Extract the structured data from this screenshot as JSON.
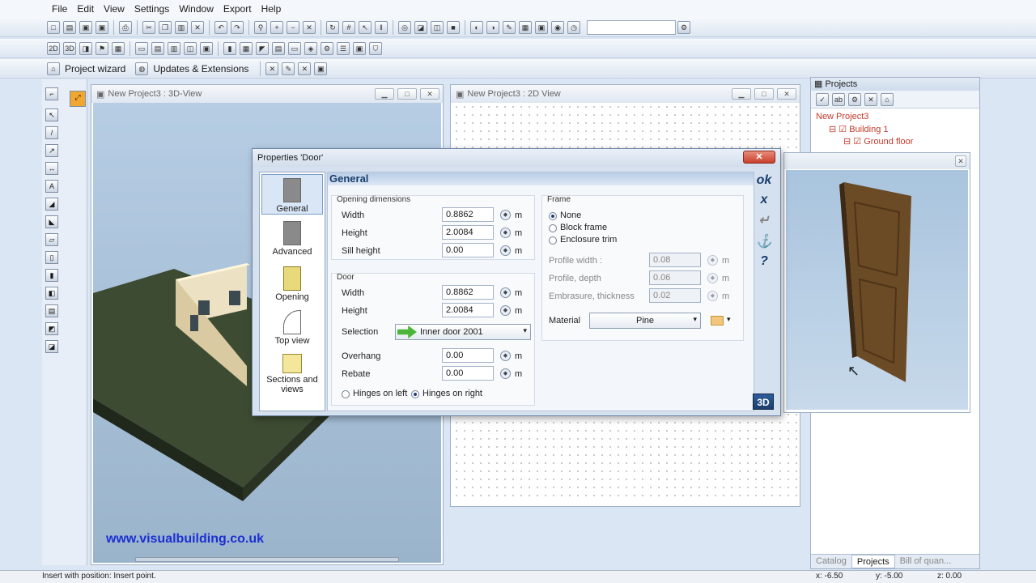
{
  "menu": [
    "File",
    "Edit",
    "View",
    "Settings",
    "Window",
    "Export",
    "Help"
  ],
  "toolbar3": {
    "wizard": "Project wizard",
    "updates": "Updates & Extensions"
  },
  "view3d": {
    "title": "New Project3 : 3D-View",
    "watermark": "www.visualbuilding.co.uk"
  },
  "view2d": {
    "title": "New Project3 : 2D View"
  },
  "dialog": {
    "title": "Properties 'Door'",
    "close": "✕",
    "header": "General",
    "nav": [
      {
        "label": "General"
      },
      {
        "label": "Advanced"
      },
      {
        "label": "Opening"
      },
      {
        "label": "Top view"
      },
      {
        "label": "Sections and views"
      }
    ],
    "opening": {
      "title": "Opening dimensions",
      "width_label": "Width",
      "width": "0.8862",
      "height_label": "Height",
      "height": "2.0084",
      "sill_label": "Sill height",
      "sill": "0.00",
      "unit": "m"
    },
    "door": {
      "title": "Door",
      "width_label": "Width",
      "width": "0.8862",
      "height_label": "Height",
      "height": "2.0084",
      "selection_label": "Selection",
      "selection": "Inner door 2001",
      "overhang_label": "Overhang",
      "overhang": "0.00",
      "rebate_label": "Rebate",
      "rebate": "0.00",
      "hinges_left": "Hinges on left",
      "hinges_right": "Hinges on right"
    },
    "frame": {
      "title": "Frame",
      "none": "None",
      "block": "Block frame",
      "enclosure": "Enclosure trim",
      "profile_width_label": "Profile width :",
      "profile_width": "0.08",
      "profile_depth_label": "Profile, depth",
      "profile_depth": "0.06",
      "embrasure_label": "Embrasure, thickness",
      "embrasure": "0.02",
      "material_label": "Material",
      "material": "Pine"
    },
    "cmds": {
      "ok": "ok",
      "cancel": "x",
      "back": "↵",
      "anchor": "⚓",
      "help": "?"
    },
    "btn3d": "3D"
  },
  "projects": {
    "title": "Projects",
    "tree": [
      "New Project3",
      "Building 1",
      "Ground floor"
    ],
    "tabs": [
      "Catalog",
      "Projects",
      "Bill of quan..."
    ]
  },
  "status": {
    "text": "Insert with position: Insert point.",
    "x": "x: -6.50",
    "y": "y: -5.00",
    "z": "z: 0.00"
  }
}
